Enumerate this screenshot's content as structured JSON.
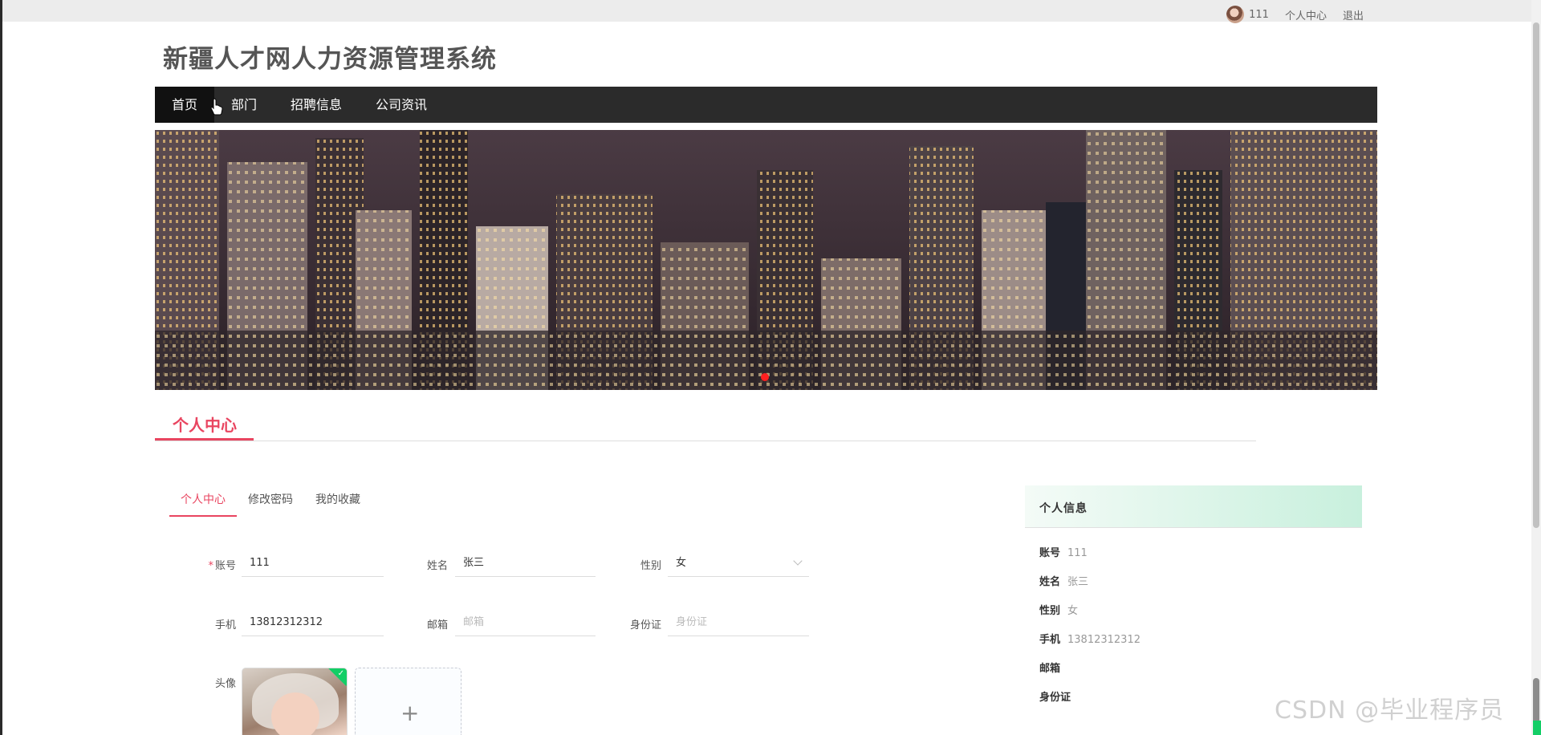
{
  "top_user": {
    "name": "111",
    "center_link": "个人中心",
    "logout_link": "退出"
  },
  "site": {
    "title": "新疆人才网人力资源管理系统"
  },
  "nav": {
    "items": [
      "首页",
      "部门",
      "招聘信息",
      "公司资讯"
    ],
    "active": "首页"
  },
  "section": {
    "title": "个人中心"
  },
  "tabs": [
    "个人中心",
    "修改密码",
    "我的收藏"
  ],
  "form": {
    "account": {
      "label": "账号",
      "value": "111",
      "required_mark": "*"
    },
    "name": {
      "label": "姓名",
      "value": "张三"
    },
    "gender": {
      "label": "性别",
      "value": "女"
    },
    "phone": {
      "label": "手机",
      "value": "13812312312"
    },
    "email": {
      "label": "邮箱",
      "placeholder": "邮箱"
    },
    "id_card": {
      "label": "身份证",
      "placeholder": "身份证"
    },
    "avatar": {
      "label": "头像",
      "add_symbol": "+"
    }
  },
  "info_panel": {
    "title": "个人信息",
    "rows": [
      {
        "key": "账号",
        "value": "111"
      },
      {
        "key": "姓名",
        "value": "张三"
      },
      {
        "key": "性别",
        "value": "女"
      },
      {
        "key": "手机",
        "value": "13812312312"
      },
      {
        "key": "邮箱",
        "value": ""
      },
      {
        "key": "身份证",
        "value": ""
      }
    ]
  },
  "watermark": "CSDN @毕业程序员",
  "colors": {
    "accent": "#e94560",
    "nav_bg": "#2b2b2b",
    "success": "#13ce66",
    "card_gradient_end": "#c8f0dd"
  },
  "icons": {
    "cursor": "hand-pointer-icon",
    "dropdown": "chevron-down-icon",
    "upload_ok": "check-icon",
    "upload_add": "plus-icon"
  }
}
